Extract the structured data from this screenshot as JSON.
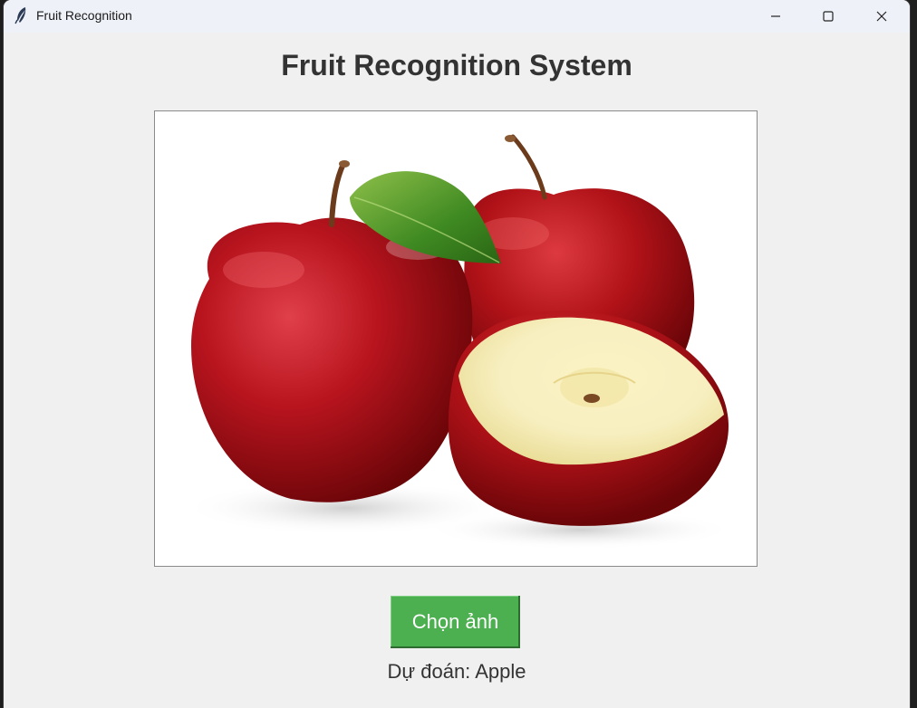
{
  "window": {
    "title": "Fruit Recognition",
    "icon": "feather-icon"
  },
  "main": {
    "heading": "Fruit Recognition System",
    "image": {
      "subject": "apple-photo",
      "icon": "apple-image"
    },
    "choose_button_label": "Chọn ảnh",
    "prediction_text": "Dự đoán: Apple"
  },
  "colors": {
    "button_bg": "#4caf50",
    "window_bg": "#f0f0f0",
    "titlebar_bg": "#eef2f8"
  }
}
